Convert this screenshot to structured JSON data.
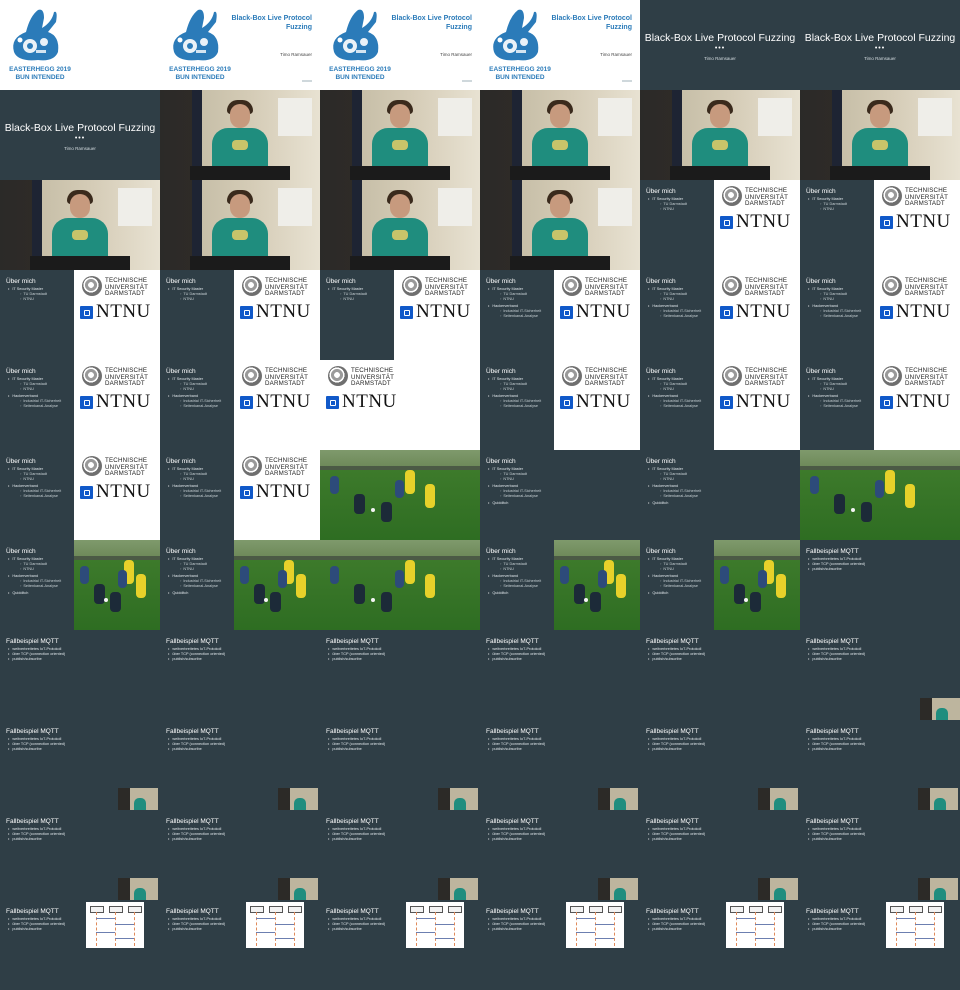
{
  "colors": {
    "slide_bg": "#2f3e46",
    "intro_blue": "#2b7bb9",
    "ntnu_blue": "#1159c9",
    "jersey_yellow": "#e7d12a"
  },
  "intro": {
    "caption_line1": "EASTERHEGG 2019",
    "caption_line2": "BUN INTENDED",
    "title_line1": "Black-Box Live Protocol",
    "title_line2": "Fuzzing",
    "author": "Timo Ramsauer"
  },
  "title_slide": {
    "title": "Black-Box Live Protocol Fuzzing",
    "dots": "•••",
    "author": "Timo Ramsauer"
  },
  "about": {
    "heading": "Über mich",
    "items": [
      {
        "text": "IT Security Master",
        "level": 1
      },
      {
        "text": "TU Darmstadt",
        "level": 2
      },
      {
        "text": "NTNU",
        "level": 2
      },
      {
        "text": "Hackerverband",
        "level": 1
      },
      {
        "text": "Industrial IT-Sicherheit",
        "level": 2
      },
      {
        "text": "Seitenkanal-Analyse",
        "level": 2
      },
      {
        "text": "Quidditch",
        "level": 1
      }
    ],
    "tud_line1": "TECHNISCHE",
    "tud_line2": "UNIVERSITÄT",
    "tud_line3": "DARMSTADT",
    "ntnu": "NTNU"
  },
  "mqtt": {
    "heading": "Fallbeispiel MQTT",
    "items": [
      "weitverbreitetes IoT-Protokoll",
      "über TCP (connection oriented)",
      "publish/subscribe"
    ],
    "diagram_boxes": [
      "client",
      "broker",
      "client"
    ]
  },
  "grid": [
    [
      "intro-logo",
      "intro-full",
      "intro-full",
      "intro-full",
      "title",
      "title"
    ],
    [
      "title",
      "photo",
      "photo",
      "photo",
      "photo",
      "photo"
    ],
    [
      "photo",
      "photo",
      "photo",
      "photo",
      "about-1",
      "about-1"
    ],
    [
      "about-1",
      "about-1",
      "about-1",
      "about-2",
      "about-2",
      "about-2"
    ],
    [
      "about-2",
      "about-2",
      "about-2-white",
      "about-2",
      "about-2",
      "about-2"
    ],
    [
      "about-2",
      "about-2",
      "football-full",
      "about-3",
      "about-3",
      "football-full"
    ],
    [
      "about-3-football",
      "about-3-football",
      "football-full",
      "about-3-football",
      "about-3-football",
      "mqtt"
    ],
    [
      "mqtt",
      "mqtt",
      "mqtt",
      "mqtt",
      "mqtt",
      "mqtt-cam-right"
    ],
    [
      "mqtt-cam-left",
      "mqtt-cam",
      "mqtt-cam",
      "mqtt-cam",
      "mqtt-cam",
      "mqtt-cam"
    ],
    [
      "mqtt-cam",
      "mqtt-cam",
      "mqtt-cam",
      "mqtt-cam",
      "mqtt-cam",
      "mqtt-cam"
    ],
    [
      "mqtt-diagram",
      "mqtt-diagram",
      "mqtt-diagram",
      "mqtt-diagram",
      "mqtt-diagram",
      "mqtt-diagram"
    ]
  ]
}
